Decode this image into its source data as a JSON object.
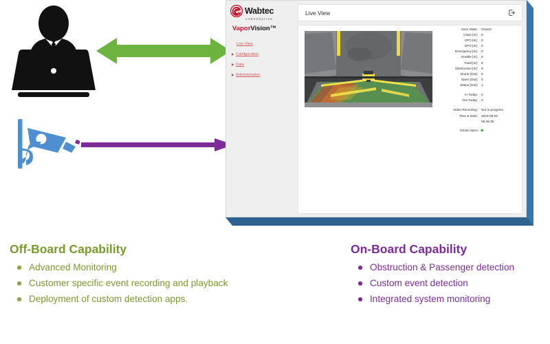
{
  "diagram": {
    "icons": {
      "offboard_operator": "person-at-laptop-icon",
      "onboard_camera": "cctv-camera-icon",
      "green_arrow": "green-double-headed-arrow",
      "purple_arrow": "purple-right-arrow"
    }
  },
  "app": {
    "brand": {
      "logo_icon": "wabtec-spiral-icon",
      "name": "Wabtec",
      "subtitle": "CORPORATION",
      "product_prefix": "Vapor",
      "product_suffix": "Vision™"
    },
    "sidebar": {
      "items": [
        {
          "label": "Live View",
          "caret": false
        },
        {
          "label": "Configuration",
          "caret": true
        },
        {
          "label": "Data",
          "caret": true
        },
        {
          "label": "Administration",
          "caret": true
        }
      ]
    },
    "header": {
      "title": "Live View",
      "logout_icon": "logout-icon"
    },
    "status": {
      "rows": [
        {
          "label": "Door State:",
          "value": "Closed"
        },
        {
          "label": "Class [In]:",
          "value": "0"
        },
        {
          "label": "DFC [In]:",
          "value": "0"
        },
        {
          "label": "DFO [In]:",
          "value": "0"
        },
        {
          "label": "Emergency [In]:",
          "value": "0"
        },
        {
          "label": "Enable [In]:",
          "value": "0"
        },
        {
          "label": "Fault [In]:",
          "value": "0"
        },
        {
          "label": "Obstruction [In]:",
          "value": "0"
        },
        {
          "label": "Drunk [Out]:",
          "value": "0"
        },
        {
          "label": "Open [Out]:",
          "value": "0"
        },
        {
          "label": "Status [Out]:",
          "value": "1"
        }
      ],
      "counters": [
        {
          "label": "In Today:",
          "value": "0"
        },
        {
          "label": "Out Today:",
          "value": "0"
        }
      ],
      "video_recording": {
        "label": "Video Recording:",
        "value": "Not in progress"
      },
      "time_date": {
        "label": "Time & Date:",
        "date": "2023-09-25",
        "time": "06:48:35"
      },
      "alarm": {
        "label": "Drunk Alarm",
        "state_color": "#2cc22c"
      }
    }
  },
  "offboard": {
    "title": "Off-Board Capability",
    "color": "#7a9a2e",
    "items": [
      "Advanced Monitoring",
      "Customer specific event recording and playback",
      "Deployment of custom detection apps."
    ]
  },
  "onboard": {
    "title": "On-Board Capability",
    "color": "#7b2c97",
    "items": [
      "Obstruction & Passenger detection",
      "Custom event detection",
      "Integrated system monitoring"
    ]
  }
}
